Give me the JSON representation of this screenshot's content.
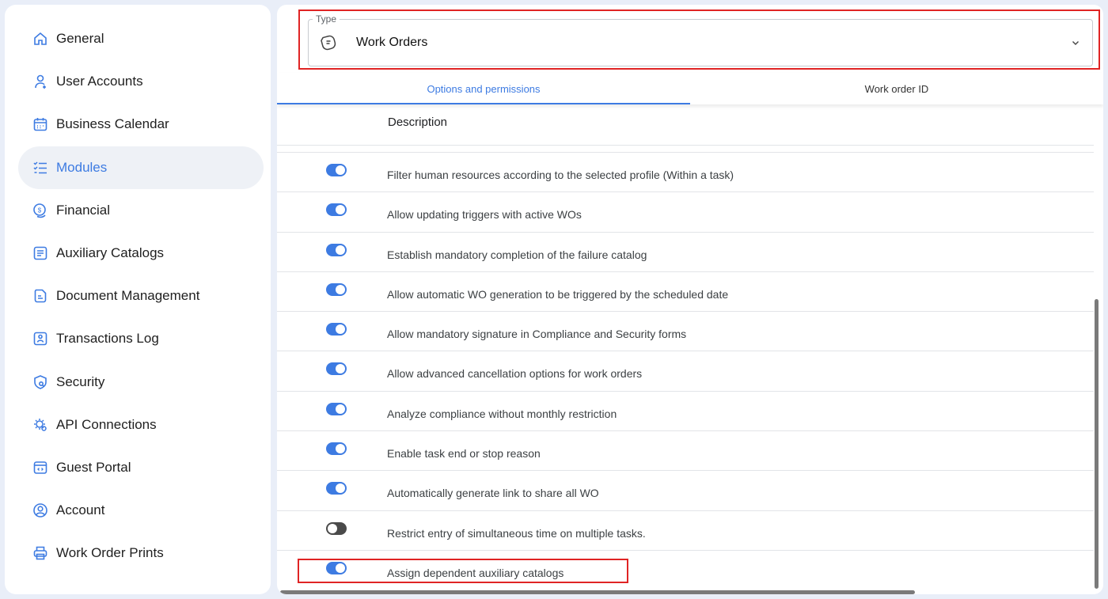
{
  "sidebar": {
    "items": [
      {
        "label": "General",
        "icon": "home-icon"
      },
      {
        "label": "User Accounts",
        "icon": "user-add-icon"
      },
      {
        "label": "Business Calendar",
        "icon": "calendar-icon"
      },
      {
        "label": "Modules",
        "icon": "list-check-icon",
        "active": true
      },
      {
        "label": "Financial",
        "icon": "coin-icon"
      },
      {
        "label": "Auxiliary Catalogs",
        "icon": "catalog-icon"
      },
      {
        "label": "Document Management",
        "icon": "document-icon"
      },
      {
        "label": "Transactions Log",
        "icon": "log-icon"
      },
      {
        "label": "Security",
        "icon": "shield-icon"
      },
      {
        "label": "API Connections",
        "icon": "api-gear-icon"
      },
      {
        "label": "Guest Portal",
        "icon": "portal-window-icon"
      },
      {
        "label": "Account",
        "icon": "account-circle-icon"
      },
      {
        "label": "Work Order Prints",
        "icon": "printer-icon"
      }
    ]
  },
  "type_field": {
    "legend": "Type",
    "value": "Work Orders"
  },
  "tabs": [
    {
      "label": "Options and permissions",
      "active": true
    },
    {
      "label": "Work order ID",
      "active": false
    }
  ],
  "table": {
    "header": "Description",
    "rows": [
      {
        "text": "Filter human resources according to the selected profile (Within a task)",
        "enabled": true
      },
      {
        "text": "Allow updating triggers with active WOs",
        "enabled": true
      },
      {
        "text": "Establish mandatory completion of the failure catalog",
        "enabled": true
      },
      {
        "text": "Allow automatic WO generation to be triggered by the scheduled date",
        "enabled": true
      },
      {
        "text": "Allow mandatory signature in Compliance and Security forms",
        "enabled": true
      },
      {
        "text": "Allow advanced cancellation options for work orders",
        "enabled": true
      },
      {
        "text": "Analyze compliance without monthly restriction",
        "enabled": true
      },
      {
        "text": "Enable task end or stop reason",
        "enabled": true
      },
      {
        "text": "Automatically generate link to share all WO",
        "enabled": true
      },
      {
        "text": "Restrict entry of simultaneous time on multiple tasks.",
        "enabled": false
      },
      {
        "text": "Assign dependent auxiliary catalogs",
        "enabled": true
      }
    ]
  },
  "colors": {
    "accent": "#3d7be2",
    "highlight": "#e02424",
    "toggle_off": "#4a4a4a"
  }
}
